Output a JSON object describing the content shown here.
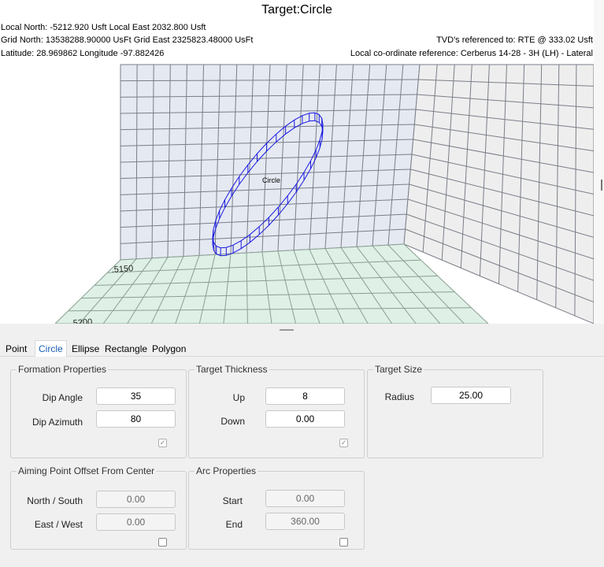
{
  "viewport": {
    "title": "Target:Circle",
    "local_coords": "Local North: -5212.920 Usft Local East 2032.800 Usft",
    "grid_coords": "Grid North: 13538288.90000 UsFt Grid East 2325823.48000 UsFt",
    "latlon": "Latitude: 28.969862 Longitude -97.882426",
    "tvd_ref": "TVD's referenced to: RTE @ 333.02 Usft",
    "local_ref": "Local co-ordinate reference: Cerberus 14-28 - 3H (LH) - Lateral",
    "target_label": "Circle",
    "axis_tick_1": ".5150",
    "axis_tick_2": ".5200",
    "colors": {
      "wall": "#e5e9f2",
      "wall_line": "#7a7e88",
      "floor": "#dff0e6",
      "floor_line": "#8aa092",
      "side": "#eeeeee",
      "target": "#1a1ae0"
    }
  },
  "tabs": [
    "Point",
    "Circle",
    "Ellipse",
    "Rectangle",
    "Polygon"
  ],
  "active_tab": "Circle",
  "formation": {
    "title": "Formation Properties",
    "dip_angle_label": "Dip Angle",
    "dip_angle": "35",
    "dip_azimuth_label": "Dip Azimuth",
    "dip_azimuth": "80",
    "checked": true
  },
  "thickness": {
    "title": "Target Thickness",
    "up_label": "Up",
    "up": "8",
    "down_label": "Down",
    "down": "0.00",
    "checked": true
  },
  "size": {
    "title": "Target Size",
    "radius_label": "Radius",
    "radius": "25.00"
  },
  "aiming": {
    "title": "Aiming Point Offset From Center",
    "ns_label": "North / South",
    "ns": "0.00",
    "ew_label": "East / West",
    "ew": "0.00",
    "checked": false
  },
  "arc": {
    "title": "Arc Properties",
    "start_label": "Start",
    "start": "0.00",
    "end_label": "End",
    "end": "360.00",
    "checked": false
  }
}
